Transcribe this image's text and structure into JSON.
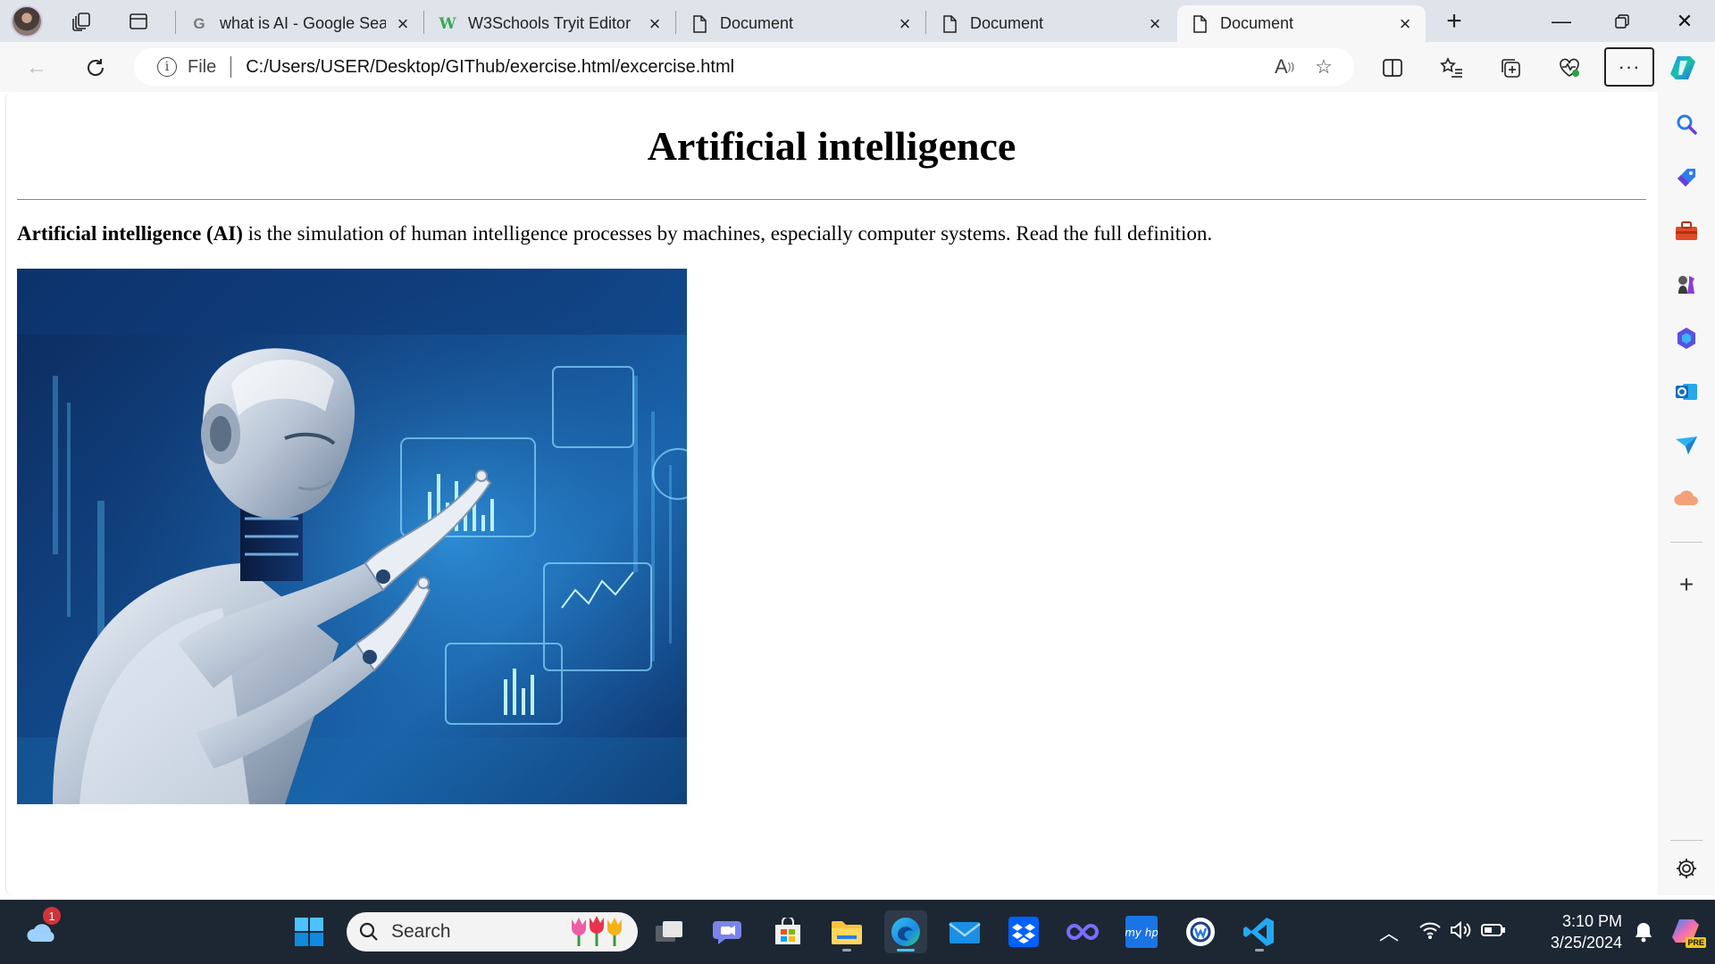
{
  "browser": {
    "tabs": [
      {
        "title": "what is AI - Google Sea",
        "favicon": "google-g-icon",
        "active": false
      },
      {
        "title": "W3Schools Tryit Editor",
        "favicon": "w3schools-icon",
        "active": false
      },
      {
        "title": "Document",
        "favicon": "document-icon",
        "active": false
      },
      {
        "title": "Document",
        "favicon": "document-icon",
        "active": false
      },
      {
        "title": "Document",
        "favicon": "document-icon",
        "active": true
      }
    ],
    "address": {
      "scheme_label": "File",
      "url": "C:/Users/USER/Desktop/GIThub/exercise.html/excercise.html",
      "read_aloud_label": "A"
    }
  },
  "page": {
    "heading": "Artificial intelligence",
    "paragraph_bold": "Artificial intelligence (AI)",
    "paragraph_rest": " is the simulation of human intelligence processes by machines, especially computer systems. Read the full definition.",
    "image_description": "robot-with-holographic-data"
  },
  "sidebar": {
    "items": [
      "search-icon",
      "tag-icon",
      "toolbox-icon",
      "chess-icon",
      "m365-icon",
      "outlook-icon",
      "send-icon",
      "cloud-icon"
    ]
  },
  "taskbar": {
    "weather_badge": "1",
    "search_placeholder": "Search",
    "clock_time": "3:10 PM",
    "clock_date": "3/25/2024",
    "copilot_badge": "PRE"
  },
  "colors": {
    "tabstrip_bg": "#dfe3ea",
    "toolbar_bg": "#f7f7f7",
    "taskbar_bg": "#1c2733",
    "accent_blue": "#0078d4"
  }
}
